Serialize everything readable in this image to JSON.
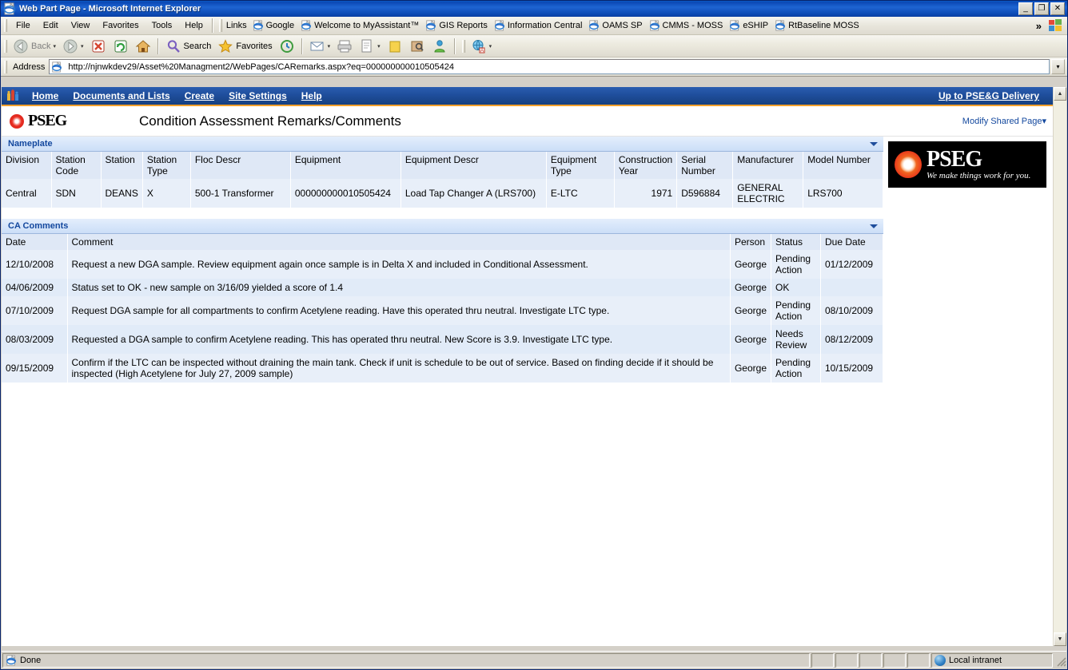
{
  "window": {
    "title": "Web Part Page - Microsoft Internet Explorer",
    "icon": "ie-document-icon",
    "minimize_label": "_",
    "maximize_label": "❐",
    "close_label": "✕"
  },
  "menu": {
    "items": [
      {
        "label": "File"
      },
      {
        "label": "Edit"
      },
      {
        "label": "View"
      },
      {
        "label": "Favorites"
      },
      {
        "label": "Tools"
      },
      {
        "label": "Help"
      }
    ]
  },
  "links": {
    "label": "Links",
    "items": [
      {
        "label": "Google"
      },
      {
        "label": "Welcome to MyAssistant™"
      },
      {
        "label": "GIS Reports"
      },
      {
        "label": "Information Central"
      },
      {
        "label": "OAMS SP"
      },
      {
        "label": "CMMS - MOSS"
      },
      {
        "label": "eSHIP"
      },
      {
        "label": "RtBaseline MOSS"
      }
    ],
    "overflow_label": "»"
  },
  "toolbar": {
    "back_label": "Back",
    "forward_label": "",
    "stop_label": "",
    "refresh_label": "",
    "home_label": "",
    "search_label": "Search",
    "favorites_label": "Favorites",
    "history_label": "",
    "mail_label": "",
    "print_label": "",
    "edit_label": "",
    "discuss_label": "",
    "research_label": "",
    "messenger_label": "",
    "translate_label": ""
  },
  "address": {
    "label": "Address",
    "url": "http://njnwkdev29/Asset%20Managment2/WebPages/CARemarks.aspx?eq=000000000010505424",
    "go_label": "▾"
  },
  "sp_nav": {
    "site_icon": "sharepoint-site-icon",
    "items": [
      {
        "label": "Home"
      },
      {
        "label": "Documents and Lists"
      },
      {
        "label": "Create"
      },
      {
        "label": "Site Settings"
      },
      {
        "label": "Help"
      }
    ],
    "up_link": "Up to PSE&G Delivery"
  },
  "header": {
    "logo_text": "PSEG",
    "page_title": "Condition Assessment Remarks/Comments",
    "modify_link": "Modify Shared Page",
    "modify_caret": "▾"
  },
  "banner": {
    "word": "PSEG",
    "tagline": "We make things work for you."
  },
  "nameplate": {
    "title": "Nameplate",
    "columns": [
      "Division",
      "Station Code",
      "Station",
      "Station Type",
      "Floc Descr",
      "Equipment",
      "Equipment Descr",
      "Equipment Type",
      "Construction Year",
      "Serial Number",
      "Manufacturer",
      "Model Number"
    ],
    "rows": [
      {
        "division": "Central",
        "station_code": "SDN",
        "station": "DEANS",
        "station_type": "X",
        "floc_descr": "500-1 Transformer",
        "equipment": "000000000010505424",
        "equipment_descr": "Load Tap Changer A (LRS700)",
        "equipment_type": "E-LTC",
        "construction_year": "1971",
        "serial_number": "D596884",
        "manufacturer": "GENERAL ELECTRIC",
        "model_number": "LRS700"
      }
    ]
  },
  "ca_comments": {
    "title": "CA Comments",
    "columns": [
      "Date",
      "Comment",
      "Person",
      "Status",
      "Due Date"
    ],
    "rows": [
      {
        "date": "12/10/2008",
        "comment": "Request a new DGA sample. Review equipment again once sample is in Delta X and included in Conditional Assessment.",
        "person": "George",
        "status": "Pending Action",
        "due_date": "01/12/2009"
      },
      {
        "date": "04/06/2009",
        "comment": "Status set to OK - new sample on 3/16/09 yielded a score of 1.4",
        "person": "George",
        "status": "OK",
        "due_date": ""
      },
      {
        "date": "07/10/2009",
        "comment": "Request DGA sample for all compartments to confirm Acetylene reading. Have this operated thru neutral. Investigate LTC type.",
        "person": "George",
        "status": "Pending Action",
        "due_date": "08/10/2009"
      },
      {
        "date": "08/03/2009",
        "comment": "Requested a DGA sample to confirm Acetylene reading. This has operated thru neutral. New Score is 3.9. Investigate LTC type.",
        "person": "George",
        "status": "Needs Review",
        "due_date": "08/12/2009"
      },
      {
        "date": "09/15/2009",
        "comment": "Confirm if the LTC can be inspected without draining the main tank. Check if unit is schedule to be out of service. Based on finding decide if it should be inspected (High Acetylene for July 27, 2009 sample)",
        "person": "George",
        "status": "Pending Action",
        "due_date": "10/15/2009"
      }
    ]
  },
  "statusbar": {
    "text": "Done",
    "zone": "Local intranet"
  },
  "colors": {
    "titlebar_blue": "#1e64d2",
    "sp_nav_blue": "#1f4e9c",
    "sp_accent_orange": "#f3a02b",
    "webpart_title_blue": "#13489e",
    "grid_row_bg": "#e8eff9",
    "pseg_red": "#ee3124"
  }
}
